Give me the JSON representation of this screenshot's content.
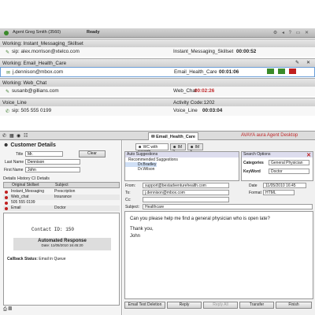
{
  "topbar": {
    "agent": "Agent Greg Smith (3560)",
    "status": "Ready"
  },
  "contacts": [
    {
      "title": "Working: Instant_Messaging_Skillset",
      "address": "sip: alex.morrison@xtelco.com",
      "queue": "Instant_Messaging_Skillset",
      "time": "00:00:52"
    },
    {
      "title": "Working: Email_Health_Care",
      "address": "j.dennison@mbox.com",
      "queue": "Email_Health_Care",
      "time": "00:01:06"
    },
    {
      "title": "Working: Web_Chat",
      "address": "susanb@gillians.com",
      "queue": "Web_Chat",
      "time": "00:02:26"
    },
    {
      "title": "Voice_Line",
      "address": "sip: 505 555 0199",
      "activity": "Activity Code:1202",
      "queue": "Voice_Line",
      "time": "00:03:04"
    }
  ],
  "tabs": {
    "main": "Email_Health_Care",
    "brand": "AVAYA aura Agent Desktop",
    "sub": [
      "WC with susanb",
      "IM 2",
      "IM 3"
    ]
  },
  "customer": {
    "heading": "Customer Details",
    "labels": {
      "title": "Title",
      "last_name": "Last Name",
      "first_name": "First Name"
    },
    "values": {
      "title": "Mr.",
      "last_name": "Dennison",
      "first_name": "John"
    },
    "clear": "Clear",
    "tabs": [
      "Details",
      "History",
      "CI Details"
    ],
    "grid_headers": [
      "Original Skillset",
      "Subject"
    ],
    "grid_rows": [
      {
        "skill": "Instant_Messaging",
        "subject": "Prescription"
      },
      {
        "skill": "Web_chat",
        "subject": "Insurance"
      },
      {
        "skill": "505 555 0199",
        "subject": ""
      },
      {
        "skill": "Email",
        "subject": "Doctor"
      }
    ],
    "contact_id": "Contact  ID:  150",
    "auto_response": "Automated Response",
    "date_line": "Date: 11/05/2010  16:45:20",
    "callback": "Callback Status:",
    "callback_value": "Email in Queue"
  },
  "suggestions": {
    "heading": "Auto Suggestions",
    "group": "Recommended Suggestions",
    "items": [
      "Dr.Bradley",
      "Dr.Wilson"
    ],
    "search_heading": "Search Options",
    "categories_label": "Categories",
    "categories_value": "General Physician",
    "keyword_label": "KeyWord",
    "keyword_value": "Doctor"
  },
  "email": {
    "from_label": "From:",
    "from": "support@bestadventurehealth.com",
    "date_label": "Date",
    "date": "11/05/2010 16:45",
    "to_label": "To:",
    "to": "j.dennison@mbox.com",
    "format_label": "Format",
    "format": "HTML",
    "cc_label": "Cc:",
    "subject_label": "Subject:",
    "subject": "Healthcare",
    "body": [
      "Can you please help me find a general physician who is open late?",
      "Thank you,",
      "John"
    ]
  },
  "actions": [
    "Email Text Deletion",
    "Reply",
    "Reply All",
    "Transfer",
    "Finish"
  ]
}
